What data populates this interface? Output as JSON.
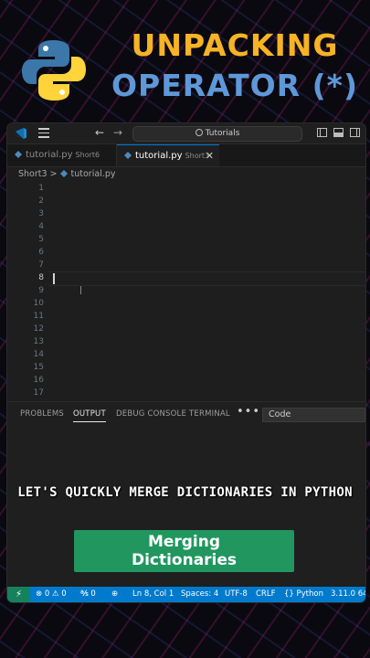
{
  "header": {
    "title_line1": "UNPACKING",
    "title_line2": "OPERATOR (*)",
    "logo_icon": "python-logo-icon",
    "colors": {
      "line1": "#f6b325",
      "line2": "#5e98d8"
    }
  },
  "titlebar": {
    "app_icon": "vscode-logo-icon",
    "menu_icon": "hamburger-menu-icon",
    "back_icon": "←",
    "forward_icon": "→",
    "search_text": "Tutorials",
    "layout_icons": [
      "toggle-sidebar-icon",
      "toggle-panel-icon",
      "toggle-secondary-sidebar-icon"
    ]
  },
  "tabs": [
    {
      "label": "tutorial.py",
      "folder": "Short6",
      "active": false
    },
    {
      "label": "tutorial.py",
      "folder": "Short3",
      "active": true,
      "close": "✕"
    }
  ],
  "breadcrumb": {
    "folder": "Short3",
    "separator": ">",
    "file": "tutorial.py"
  },
  "editor": {
    "line_numbers": [
      "1",
      "2",
      "3",
      "4",
      "5",
      "6",
      "7",
      "8",
      "9",
      "10",
      "11",
      "12",
      "13",
      "14",
      "15",
      "16",
      "17"
    ],
    "active_line": 8
  },
  "panel": {
    "tabs": [
      "PROBLEMS",
      "OUTPUT",
      "DEBUG CONSOLE",
      "TERMINAL"
    ],
    "active_tab": "OUTPUT",
    "more": "•••",
    "channel_select": "Code"
  },
  "statusbar": {
    "remote": "⚡",
    "problems": "⊗ 0 ⚠ 0",
    "ports": "℁ 0",
    "zoom": "⊕",
    "position": "Ln 8, Col 1",
    "spaces": "Spaces: 4",
    "encoding": "UTF-8",
    "eol": "CRLF",
    "language": "{} Python",
    "version": "3.11.0 64",
    "color": "#007acc"
  },
  "overlay": {
    "caption": "LET'S QUICKLY MERGE DICTIONARIES IN PYTHON",
    "button_line1": "Merging",
    "button_line2": "Dictionaries",
    "button_color": "#21965f"
  }
}
